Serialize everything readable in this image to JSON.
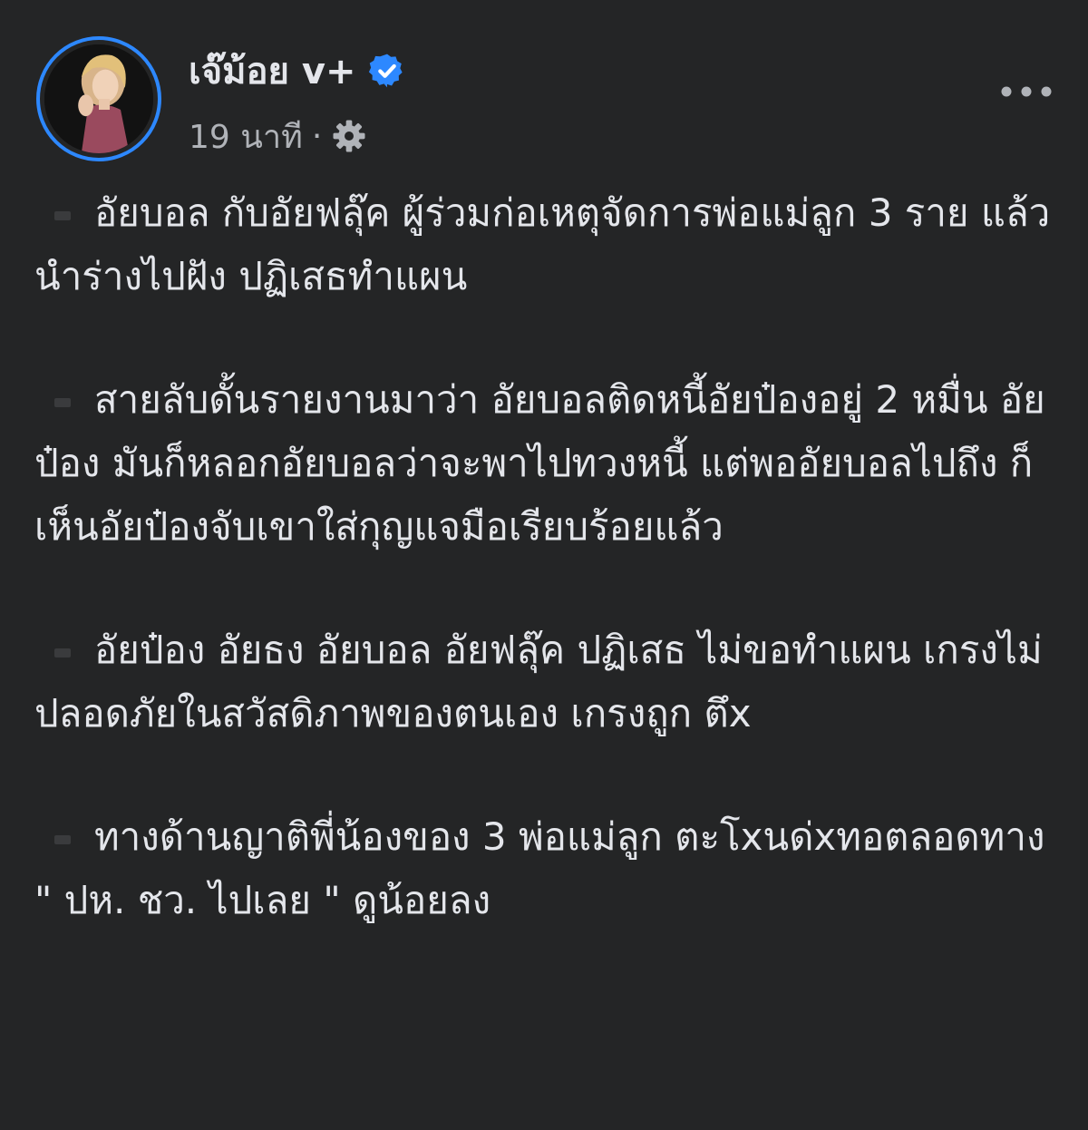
{
  "author": {
    "name": "เจ๊ม้อย v+",
    "verified": true
  },
  "meta": {
    "timestamp": "19 นาที",
    "separator": "·"
  },
  "colors": {
    "background": "#242526",
    "text": "#e4e6eb",
    "secondary_text": "#b0b3b8",
    "accent": "#2d88ff"
  },
  "icons": {
    "verified": "verified-badge-icon",
    "audience": "gear-icon",
    "more": "more-options-icon"
  },
  "post": {
    "paragraphs": [
      "อัยบอล กับอัยฟลุ๊ค ผู้ร่วมก่อเหตุจัดการพ่อแม่ลูก 3 ราย แล้วนำร่างไปฝัง ปฏิเสธทำแผน",
      "สายลับดั้นรายงานมาว่า อัยบอลติดหนี้อัยป๋องอยู่ 2 หมื่น อัยป๋อง มันก็หลอกอัยบอลว่าจะพาไปทวงหนี้ แต่พออัยบอลไปถึง ก็เห็นอัยป๋องจับเขาใส่กุญแจมือเรียบร้อยแล้ว",
      "อัยป๋อง อัยธง อัยบอล อัยฟลุ๊ค ปฏิเสธ ไม่ขอทำแผน เกรงไม่ปลอดภัยในสวัสดิภาพของตนเอง เกรงถูก ตึx",
      "ทางด้านญาติพี่น้องของ 3 พ่อแม่ลูก ตะโxนด่xทอตลอดทาง \" ปห. ชว. ไปเลย \" ดูน้อยลง"
    ]
  }
}
